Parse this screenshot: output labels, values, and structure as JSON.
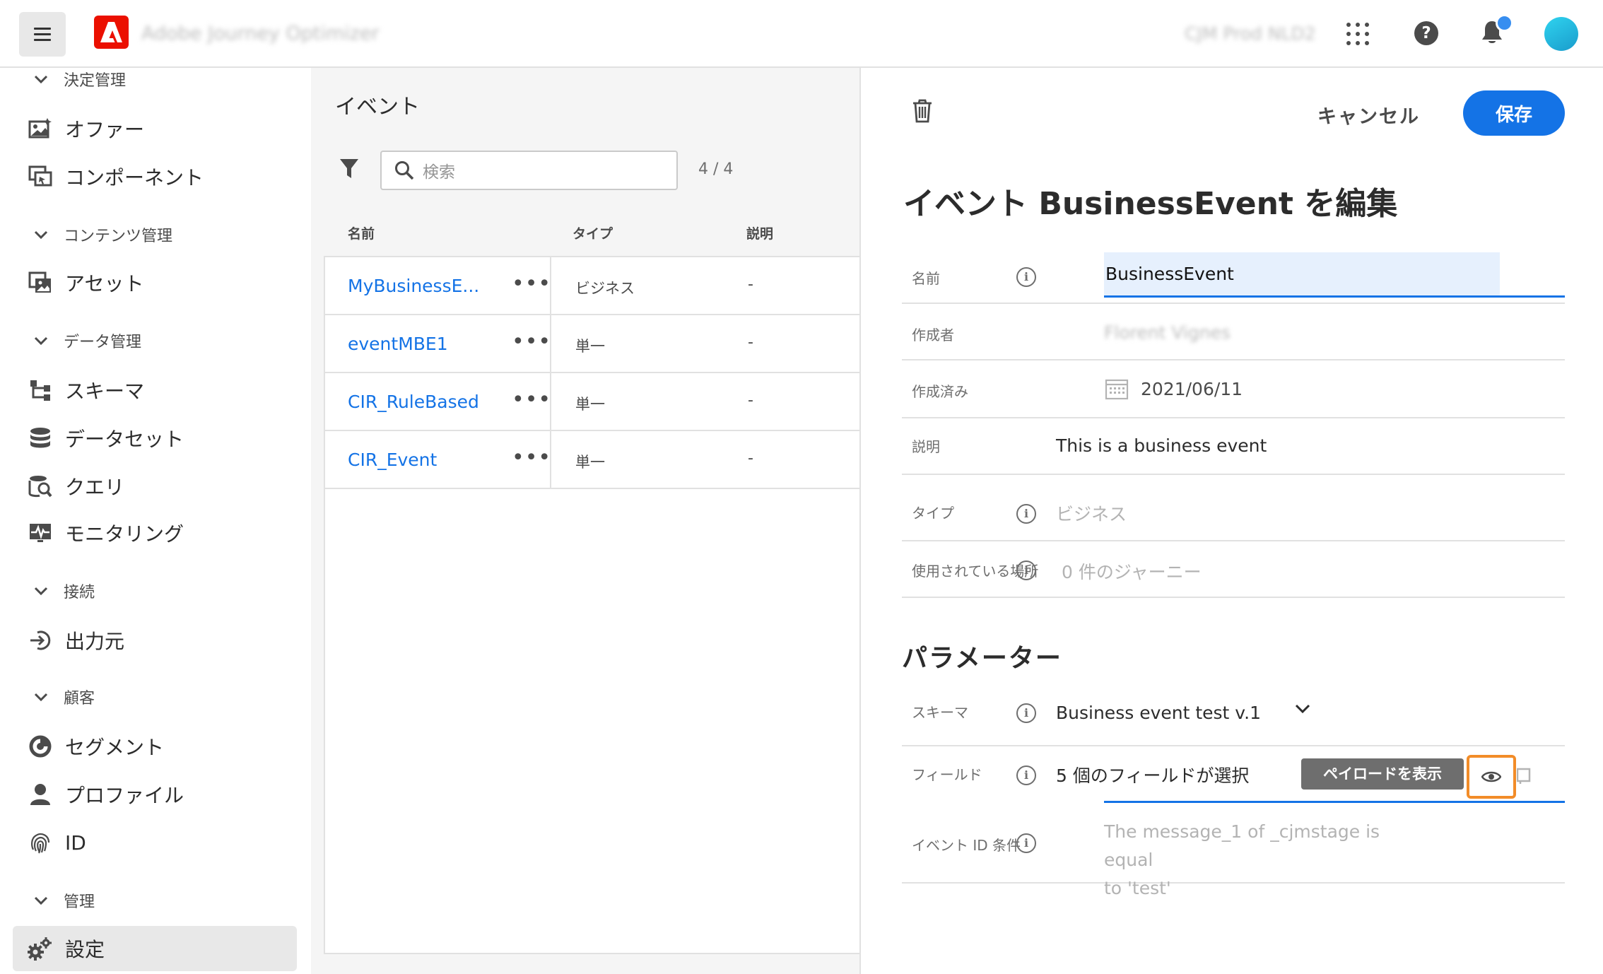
{
  "header": {
    "app_name": "Adobe Journey Optimizer",
    "org_name": "CJM Prod NLD2"
  },
  "sidebar": {
    "sections": [
      {
        "label": "決定管理"
      },
      {
        "label": "コンテンツ管理"
      },
      {
        "label": "データ管理"
      },
      {
        "label": "接続"
      },
      {
        "label": "顧客"
      },
      {
        "label": "管理"
      }
    ],
    "items": [
      {
        "label": "オファー"
      },
      {
        "label": "コンポーネント"
      },
      {
        "label": "アセット"
      },
      {
        "label": "スキーマ"
      },
      {
        "label": "データセット"
      },
      {
        "label": "クエリ"
      },
      {
        "label": "モニタリング"
      },
      {
        "label": "出力元"
      },
      {
        "label": "セグメント"
      },
      {
        "label": "プロファイル"
      },
      {
        "label": "ID"
      },
      {
        "label": "設定"
      }
    ]
  },
  "events_list": {
    "title": "イベント",
    "search_placeholder": "検索",
    "count": "4 / 4",
    "columns": {
      "name": "名前",
      "type": "タイプ",
      "description": "説明"
    },
    "rows": [
      {
        "name": "MyBusinessE...",
        "type": "ビジネス",
        "description": "-"
      },
      {
        "name": "eventMBE1",
        "type": "単一",
        "description": "-"
      },
      {
        "name": "CIR_RuleBased",
        "type": "単一",
        "description": "-"
      },
      {
        "name": "CIR_Event",
        "type": "単一",
        "description": "-"
      }
    ],
    "more_glyph": "•••"
  },
  "edit_panel": {
    "cancel_label": "キャンセル",
    "save_label": "保存",
    "title": "イベント BusinessEvent を編集",
    "fields": {
      "name_label": "名前",
      "name_value": "BusinessEvent",
      "author_label": "作成者",
      "author_value": "Florent Vignes",
      "created_label": "作成済み",
      "created_value": "2021/06/11",
      "description_label": "説明",
      "description_value": "This is a business event",
      "type_label": "タイプ",
      "type_value": "ビジネス",
      "used_in_label": "使用されている場所",
      "used_in_value": "0 件のジャーニー"
    },
    "parameters_title": "パラメーター",
    "params": {
      "schema_label": "スキーマ",
      "schema_value": "Business event test v.1",
      "fields_label": "フィールド",
      "fields_value": "5 個のフィールドが選択",
      "tooltip": "ペイロードを表示",
      "event_id_label": "イベント ID 条件",
      "event_id_value_line1": "The message_1 of _cjmstage is equal",
      "event_id_value_line2": "to 'test'"
    },
    "info_glyph": "i"
  },
  "colors": {
    "accent": "#1473e6",
    "adobe_red": "#eb1000",
    "highlight": "#f28c28",
    "tooltip_bg": "#6e6e6e"
  }
}
